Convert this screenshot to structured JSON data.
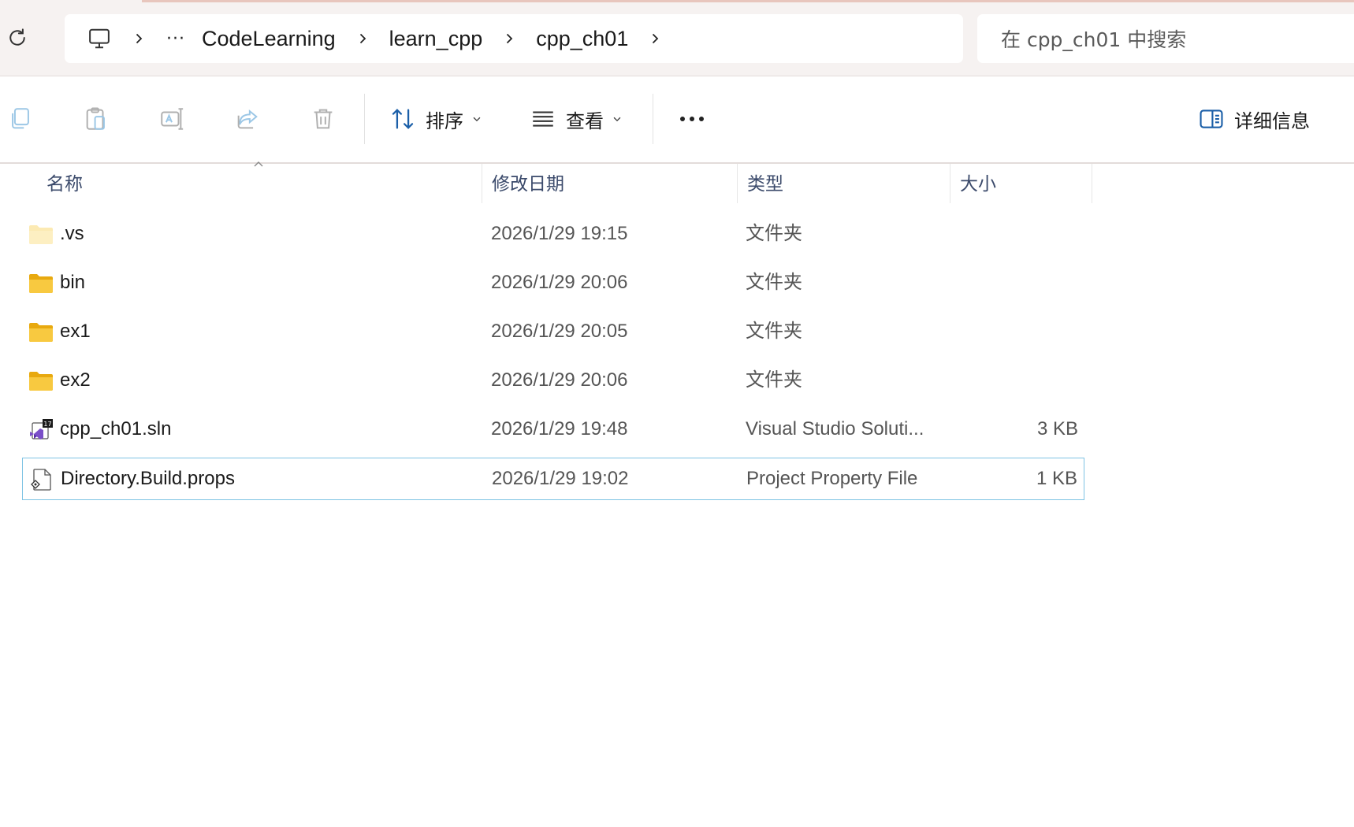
{
  "address_bar": {
    "more_label": "···",
    "crumbs": [
      "CodeLearning",
      "learn_cpp",
      "cpp_ch01"
    ],
    "search_placeholder": "在 cpp_ch01 中搜索"
  },
  "command_bar": {
    "sort_label": "排序",
    "view_label": "查看",
    "details_label": "详细信息"
  },
  "columns": {
    "name": "名称",
    "date": "修改日期",
    "type": "类型",
    "size": "大小"
  },
  "files": [
    {
      "name": ".vs",
      "date": "2026/1/29 19:15",
      "type": "文件夹",
      "size": "",
      "icon": "folder-hidden-icon"
    },
    {
      "name": "bin",
      "date": "2026/1/29 20:06",
      "type": "文件夹",
      "size": "",
      "icon": "folder-icon"
    },
    {
      "name": "ex1",
      "date": "2026/1/29 20:05",
      "type": "文件夹",
      "size": "",
      "icon": "folder-icon"
    },
    {
      "name": "ex2",
      "date": "2026/1/29 20:06",
      "type": "文件夹",
      "size": "",
      "icon": "folder-icon"
    },
    {
      "name": "cpp_ch01.sln",
      "date": "2026/1/29 19:48",
      "type": "Visual Studio Soluti...",
      "size": "3 KB",
      "icon": "visual-studio-solution-icon"
    },
    {
      "name": "Directory.Build.props",
      "date": "2026/1/29 19:02",
      "type": "Project Property File",
      "size": "1 KB",
      "icon": "property-file-icon",
      "selected": true
    }
  ],
  "colors": {
    "accent": "#0067c0",
    "folder_yellow": "#f8c940",
    "selection_border": "#7ec3e4",
    "header_text": "#3b4a6b"
  }
}
